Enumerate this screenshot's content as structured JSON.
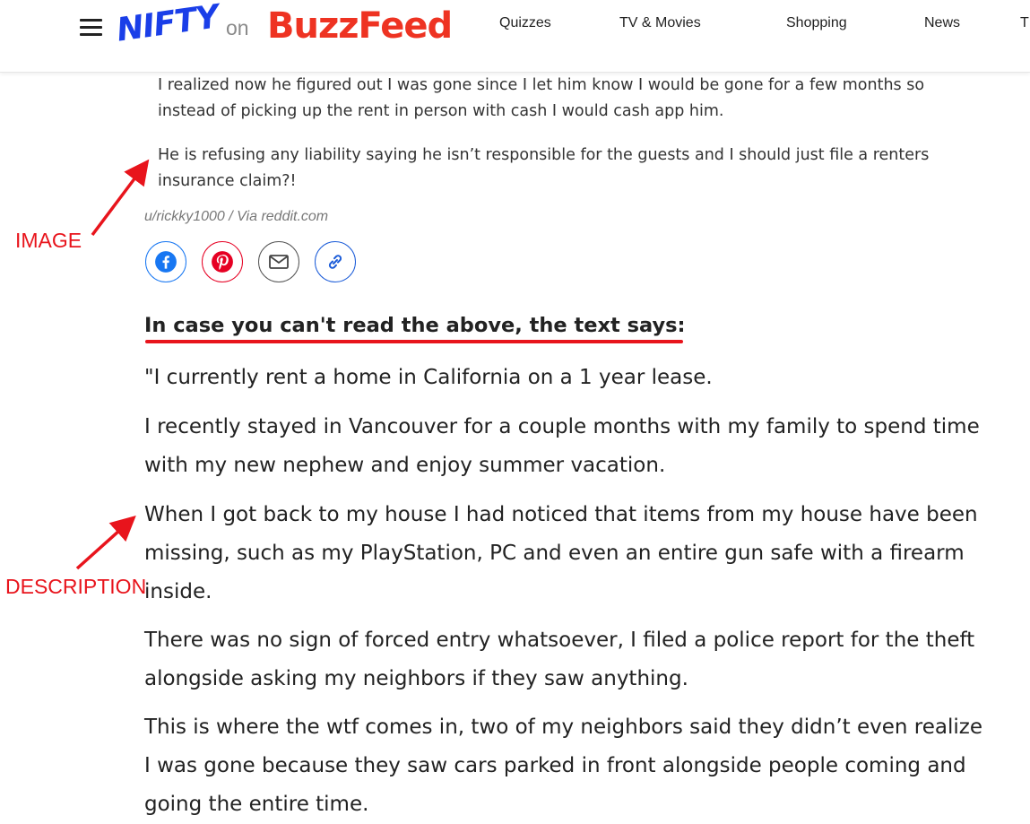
{
  "header": {
    "brand_nifty": "NIFTY",
    "brand_on": "on",
    "brand_buzzfeed": "BuzzFeed",
    "nav": [
      "Quizzes",
      "TV & Movies",
      "Shopping",
      "News",
      "T"
    ]
  },
  "embedded_image": {
    "paragraph_1": "I realized now he figured out I was gone since I let him know I would be gone for a few months so instead of picking up the rent in person with cash I would cash app him.",
    "paragraph_2": "He is refusing any liability saying he isn’t responsible for the guests and I should just file a renters insurance claim?!",
    "credit": "u/rickky1000 / Via reddit.com"
  },
  "share": {
    "icons": [
      "facebook-icon",
      "pinterest-icon",
      "email-icon",
      "link-icon"
    ],
    "colors": {
      "facebook": "#1877f2",
      "pinterest": "#e60023",
      "email": "#555555",
      "link": "#1a5bd8"
    }
  },
  "article": {
    "subhead": "In case you can't read the above, the text says:",
    "paragraphs": [
      "\"I currently rent a home in California on a 1 year lease.",
      "I recently stayed in Vancouver for a couple months with my family to spend time with my new nephew and enjoy summer vacation.",
      "When I got back to my house I had noticed that items from my house have been missing, such as my PlayStation, PC and even an entire gun safe with a firearm inside.",
      "There was no sign of forced entry whatsoever, I filed a police report for the theft alongside asking my neighbors if they saw anything.",
      "This is where the wtf comes in, two of my neighbors said they didn’t even realize I was gone because they saw cars parked in front alongside people coming and going the entire time."
    ]
  },
  "annotations": {
    "image_label": "IMAGE",
    "description_label": "DESCRIPTION",
    "color": "#e8141c"
  }
}
